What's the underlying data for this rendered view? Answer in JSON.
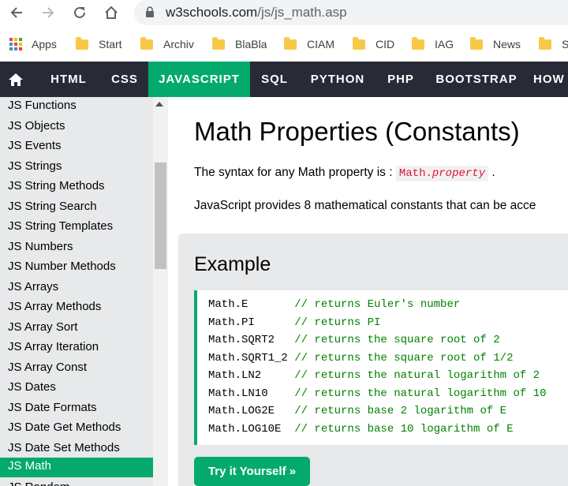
{
  "browser": {
    "url_domain": "w3schools.com",
    "url_path": "/js/js_math.asp"
  },
  "bookmarks": [
    {
      "label": "Apps",
      "icon": "apps-grid-icon"
    },
    {
      "label": "Start",
      "icon": "folder-icon"
    },
    {
      "label": "Archiv",
      "icon": "folder-icon"
    },
    {
      "label": "BlaBla",
      "icon": "folder-icon"
    },
    {
      "label": "CIAM",
      "icon": "folder-icon"
    },
    {
      "label": "CID",
      "icon": "folder-icon"
    },
    {
      "label": "IAG",
      "icon": "folder-icon"
    },
    {
      "label": "News",
      "icon": "folder-icon"
    },
    {
      "label": "S",
      "icon": "folder-icon"
    }
  ],
  "topnav": {
    "items": [
      "HTML",
      "CSS",
      "JAVASCRIPT",
      "SQL",
      "PYTHON",
      "PHP",
      "BOOTSTRAP",
      "HOW"
    ],
    "active": "JAVASCRIPT"
  },
  "sidebar": {
    "items": [
      "JS Functions",
      "JS Objects",
      "JS Events",
      "JS Strings",
      "JS String Methods",
      "JS String Search",
      "JS String Templates",
      "JS Numbers",
      "JS Number Methods",
      "JS Arrays",
      "JS Array Methods",
      "JS Array Sort",
      "JS Array Iteration",
      "JS Array Const",
      "JS Dates",
      "JS Date Formats",
      "JS Date Get Methods",
      "JS Date Set Methods",
      "JS Math",
      "JS Random"
    ],
    "active": "JS Math"
  },
  "main": {
    "title": "Math Properties (Constants)",
    "syntax_text": "The syntax for any Math property is : ",
    "syntax_code": "Math.",
    "syntax_code_italic": "property",
    "syntax_end": " .",
    "provides_text": "JavaScript provides 8 mathematical constants that can be acce"
  },
  "example": {
    "title": "Example",
    "code_lines": [
      {
        "code": "Math.E       ",
        "comment": "// returns Euler's number"
      },
      {
        "code": "Math.PI      ",
        "comment": "// returns PI"
      },
      {
        "code": "Math.SQRT2   ",
        "comment": "// returns the square root of 2"
      },
      {
        "code": "Math.SQRT1_2 ",
        "comment": "// returns the square root of 1/2"
      },
      {
        "code": "Math.LN2     ",
        "comment": "// returns the natural logarithm of 2"
      },
      {
        "code": "Math.LN10    ",
        "comment": "// returns the natural logarithm of 10"
      },
      {
        "code": "Math.LOG2E   ",
        "comment": "// returns base 2 logarithm of E"
      },
      {
        "code": "Math.LOG10E  ",
        "comment": "// returns base 10 logarithm of E"
      }
    ],
    "try_button": "Try it Yourself »"
  },
  "colors": {
    "accent": "#04AA6D",
    "topnav_bg": "#282A35",
    "sidebar_bg": "#E7E9EB"
  }
}
